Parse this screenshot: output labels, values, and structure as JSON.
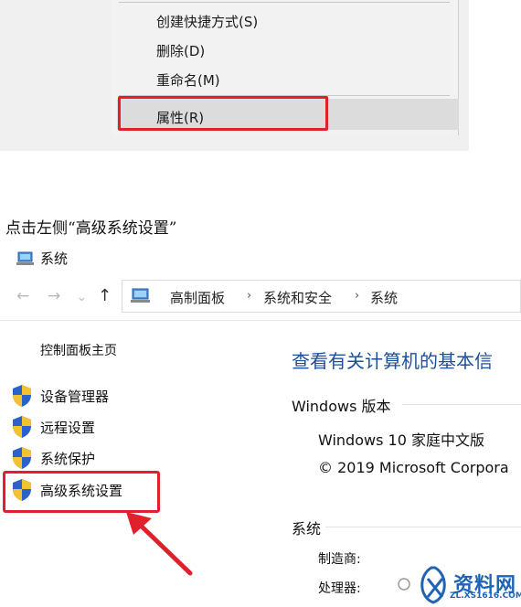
{
  "context_menu": {
    "items": [
      "创建快捷方式(S)",
      "删除(D)",
      "重命名(M)",
      "属性(R)"
    ]
  },
  "caption": "点击左侧“高级系统设置”",
  "window": {
    "title": "系统",
    "breadcrumb": [
      "高制面板",
      "系统和安全",
      "系统"
    ],
    "breadcrumb_sep": "›",
    "nav": {
      "back": "←",
      "forward": "→",
      "recent": "⌄",
      "up": "↑"
    }
  },
  "sidebar": {
    "home": "控制面板主页",
    "items": [
      "设备管理器",
      "远程设置",
      "系统保护",
      "高级系统设置"
    ]
  },
  "main": {
    "title": "查看有关计算机的基本信",
    "windows_edition": {
      "heading": "Windows 版本",
      "edition": "Windows 10 家庭中文版",
      "copyright": "© 2019 Microsoft Corpora"
    },
    "system": {
      "heading": "系统",
      "manufacturer_label": "制造商:",
      "processor_label": "处理器:"
    }
  },
  "watermark": {
    "brand": "资料网",
    "url": "ZL.XS1616.COM"
  },
  "colors": {
    "highlight_red": "#e0202a",
    "link_blue": "#1e4f99"
  }
}
